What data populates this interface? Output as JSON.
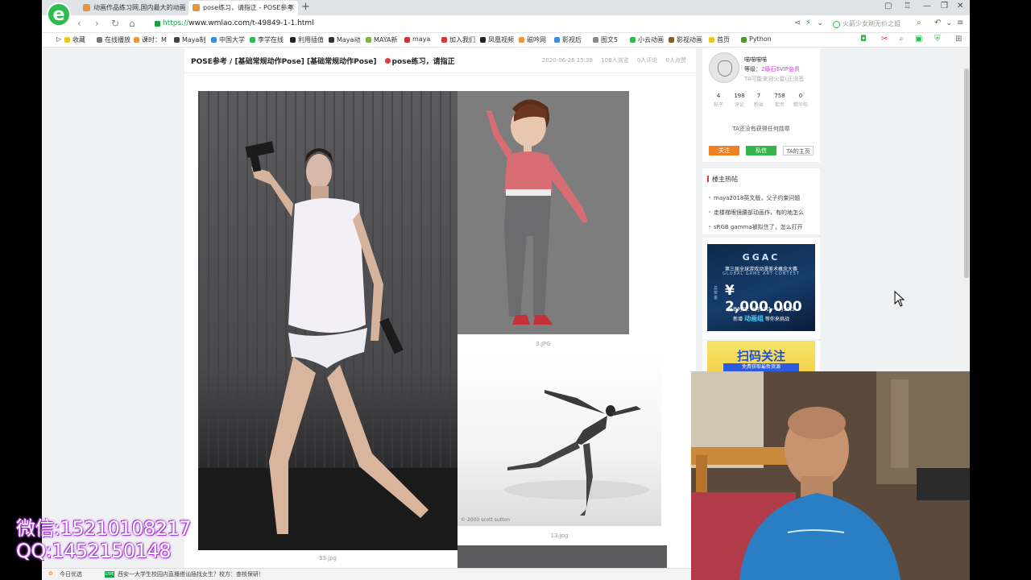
{
  "browser": {
    "tabs": [
      {
        "label": "动画作品练习网,国内最大的动画"
      },
      {
        "label": "pose练习，请指正 - POSE参考"
      }
    ],
    "new_tab": "+",
    "url_scheme": "https://",
    "url_rest": "www.wmlao.com/t-49849-1-1.html",
    "search_placeholder": "火箭少女刷无价之姐",
    "bookmarks": [
      "收藏",
      "在线播放",
      "课时：M",
      "Maya制",
      "中国大学",
      "李学在线",
      "利用插值",
      "Maya动",
      "MAYA新",
      "maya",
      "加入我们",
      "凤凰视频",
      "磁吟网",
      "影视后",
      "图文5",
      "小云动画",
      "影视动画",
      "首页",
      "Python"
    ]
  },
  "post": {
    "breadcrumb": "POSE参考 /",
    "tags": "[基础常规动作Pose] [基础常规动作Pose]",
    "title": "pose练习，请指正",
    "date": "2020-06-26 15:38",
    "views": "108人浏览",
    "comments": "0人评论",
    "likes": "0人点赞",
    "captions": {
      "photo1": "33.jpg",
      "photo2": "3.JPG",
      "photo3": "13.jpg",
      "photo3_credit": "© 2000 scott sutton"
    }
  },
  "sidebar": {
    "user": {
      "name": "喵喵喵喵",
      "level_label": "等级：",
      "level_value": "2级石SVIP会员",
      "signature": "TA可能来自火星(还没签"
    },
    "stats": [
      {
        "value": "4",
        "label": "帖子"
      },
      {
        "value": "198",
        "label": "评论"
      },
      {
        "value": "7",
        "label": "粉丝"
      },
      {
        "value": "758",
        "label": "街币"
      },
      {
        "value": "0",
        "label": "精华帖"
      }
    ],
    "no_medal": "TA还没有获得任何勋章",
    "buttons": {
      "follow": "关注",
      "message": "私信",
      "home": "TA的主页"
    },
    "hot_title": "楼主热帖",
    "hot_posts": [
      "maya2018英文版，父子约束问题",
      "走楼梯眼镜腰部动画作，有的地怎么",
      "sRGB gamma被拟住了，怎么打开"
    ],
    "ad1": {
      "brand": "GGAC",
      "line1": "第三届全球游戏动漫美术概念大赛",
      "line2": "GLOBAL GAME ART CONTEST",
      "prize_label": "总奖金",
      "prize": "¥ 2,000,000",
      "period": "报名时间：4月22日－9月30日",
      "group_prefix": "新增",
      "group": "动画组",
      "group_suffix": "等你来挑战"
    },
    "ad2": {
      "title": "扫码关注",
      "sub": "免费获取最新资源"
    }
  },
  "statusbar": {
    "left": "今日优选",
    "badge": "LIVE",
    "news": "西安一大学生校园内直播搭讪插找女生？校方：查核保研！"
  },
  "watermark": {
    "wechat": "微信:15210108217",
    "qq": "QQ:1452150148"
  },
  "colors": {
    "accent_green": "#2bbd4e",
    "follow_orange": "#f08020",
    "message_green": "#35b54a",
    "title_red": "#e03b3b",
    "watermark_purple": "#b44bd8"
  }
}
